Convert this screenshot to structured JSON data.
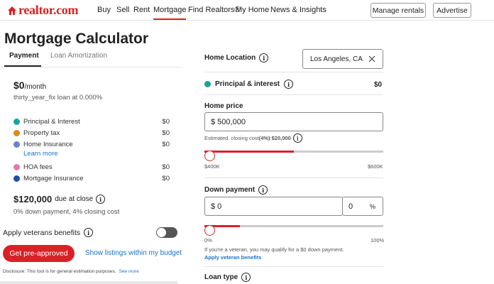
{
  "nav": {
    "logo": "realtor.com",
    "links": [
      "Buy",
      "Sell",
      "Rent",
      "Mortgage",
      "Find Realtors®",
      "My Home",
      "News & Insights"
    ],
    "manage_rentals": "Manage rentals",
    "advertise": "Advertise"
  },
  "page_title": "Mortgage Calculator",
  "tabs": [
    "Payment",
    "Loan Amortization"
  ],
  "summary": {
    "monthly_amount": "$0",
    "monthly_unit": "/month",
    "loan_desc": "thirty_year_fix loan at 0.000%"
  },
  "breakdown": [
    {
      "label": "Principal & Interest",
      "value": "$0",
      "color": "#1aa39a"
    },
    {
      "label": "Property tax",
      "value": "$0",
      "color": "#d98a1a"
    },
    {
      "label": "Home Insurance",
      "value": "$0",
      "color": "#6a7fd8"
    },
    {
      "label": "HOA fees",
      "value": "$0",
      "color": "#e07aa8"
    },
    {
      "label": "Mortgage Insurance",
      "value": "$0",
      "color": "#1d4fa8"
    }
  ],
  "learn_more": "Learn more",
  "due_at_close": {
    "amount": "$120,000",
    "suffix": "due at close",
    "detail": "0% down payment, 4% closing cost"
  },
  "veterans": {
    "label": "Apply veterans benefits",
    "on": false
  },
  "get_preapproved": "Get pre-approved",
  "show_listings": "Show listings within my budget",
  "disclosure": "Disclosure: This tool is for general estimation purposes.",
  "see_more": "See more",
  "right": {
    "home_location_label": "Home Location",
    "home_location_value": "Los Angeles, CA",
    "principal_label": "Principal & interest",
    "principal_value": "$0",
    "home_price_label": "Home price",
    "home_price_value": "$ 500,000",
    "closing_cost_prefix": "Estimated. closing cost ",
    "closing_cost_pct": "(4%)",
    "closing_cost_sep": " : ",
    "closing_cost_value": "$20,000",
    "price_slider_fraction": 0.0,
    "price_min": "$400K",
    "price_max": "$600K",
    "down_payment_label": "Down payment",
    "down_payment_value": "$ 0",
    "down_payment_pct": "0",
    "pct_symbol": "%",
    "down_slider_fraction": 0.0,
    "down_min": "0%",
    "down_max": "100%",
    "veteran_note": "If you're a veteran, you may qualify for a $0 down payment.",
    "apply_veteran": "Apply veteran benefits",
    "loan_type_label": "Loan type"
  },
  "colors": {
    "accent": "#d92228",
    "link": "#1a73c9",
    "principal_dot": "#1aa39a"
  }
}
